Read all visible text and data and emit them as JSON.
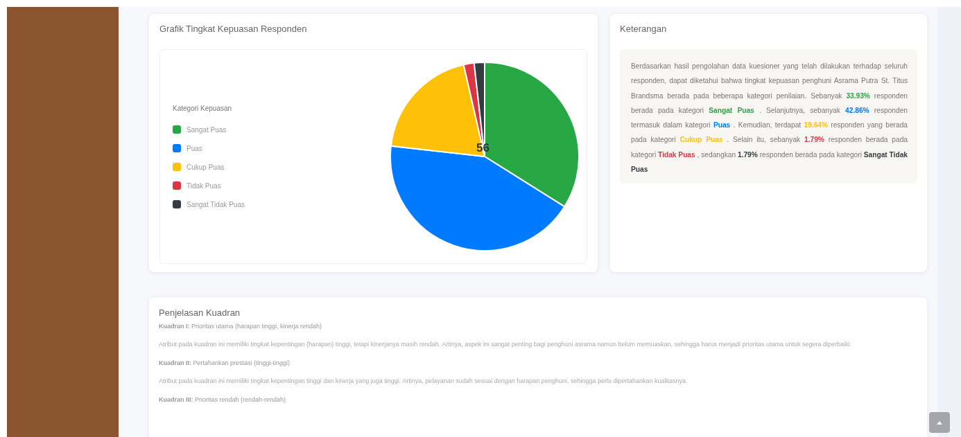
{
  "chart_card": {
    "title": "Grafik Tingkat Kepuasan Responden",
    "legend_title": "Kategori Kepuasan",
    "center_total": "56",
    "chart_data": {
      "type": "pie",
      "categories": [
        "Sangat Puas",
        "Puas",
        "Cukup Puas",
        "Tidak Puas",
        "Sangat Tidak Puas"
      ],
      "series": [
        {
          "colors": [
            "#28a745",
            "#007bff",
            "#ffc107",
            "#dc3545",
            "#343a40"
          ],
          "values": [
            33.93,
            42.86,
            19.64,
            1.79,
            1.79
          ]
        }
      ]
    }
  },
  "info_card": {
    "title": "Keterangan",
    "paragraph": [
      {
        "kind": "plain",
        "text": "Berdasarkan hasil pengolahan data kuesioner yang telah dilakukan terhadap seluruh responden, dapat diketahui bahwa tingkat kepuasan penghuni Asrama Putra St. Titus Brandsma berada pada beberapa kategori penilaian. Sebanyak "
      },
      {
        "kind": "bold",
        "text": "33.93%",
        "color": "#28a745"
      },
      {
        "kind": "plain",
        "text": " responden berada pada kategori "
      },
      {
        "kind": "bold",
        "text": "Sangat Puas",
        "color": "#28a745"
      },
      {
        "kind": "plain",
        "text": " . Selanjutnya, sebanyak "
      },
      {
        "kind": "bold",
        "text": "42.86%",
        "color": "#007bff"
      },
      {
        "kind": "plain",
        "text": " responden termasuk dalam kategori "
      },
      {
        "kind": "bold",
        "text": "Puas",
        "color": "#007bff"
      },
      {
        "kind": "plain",
        "text": " . Kemudian, terdapat "
      },
      {
        "kind": "bold",
        "text": "19.64%",
        "color": "#ffc107"
      },
      {
        "kind": "plain",
        "text": " responden yang berada pada kategori "
      },
      {
        "kind": "bold",
        "text": "Cukup Puas",
        "color": "#ffc107"
      },
      {
        "kind": "plain",
        "text": " . Selain itu, sebanyak "
      },
      {
        "kind": "bold",
        "text": "1.79%",
        "color": "#dc3545"
      },
      {
        "kind": "plain",
        "text": " responden berada pada kategori "
      },
      {
        "kind": "bold",
        "text": "Tidak Puas",
        "color": "#dc3545"
      },
      {
        "kind": "plain",
        "text": " , sedangkan "
      },
      {
        "kind": "bold",
        "text": "1.79%",
        "color": "#343a40"
      },
      {
        "kind": "plain",
        "text": " responden berada pada kategori "
      },
      {
        "kind": "bold",
        "text": "Sangat Tidak Puas",
        "color": "#343a40"
      }
    ]
  },
  "quadrant_card": {
    "title": "Penjelasan Kuadran",
    "items": [
      {
        "kind": "heading",
        "text": "**Kuadran I:** Prioritas utama (harapan tinggi, kinerja rendah)"
      },
      {
        "kind": "description",
        "text": "Atribut pada kuadran ini memiliki tingkat kepentingan (harapan) tinggi, tetapi kinerjanya masih rendah. Artinya, aspek ini sangat penting bagi penghuni asrama namun belum memuaskan, sehingga harus menjadi prioritas utama untuk segera diperbaiki."
      },
      {
        "kind": "heading",
        "text": "**Kuadran II:** Pertahankan prestasi (tinggi-tinggi)"
      },
      {
        "kind": "description",
        "text": "Atribut pada kuadran ini memiliki tingkat kepentingan tinggi dan kinerja yang juga tinggi. Artinya, pelayanan sudah sesuai dengan harapan penghuni, sehingga perlu dipertahankan kualitasnya."
      },
      {
        "kind": "heading",
        "text": "**Kuadran III:** Prioritas rendah (rendah-rendah)"
      }
    ]
  }
}
